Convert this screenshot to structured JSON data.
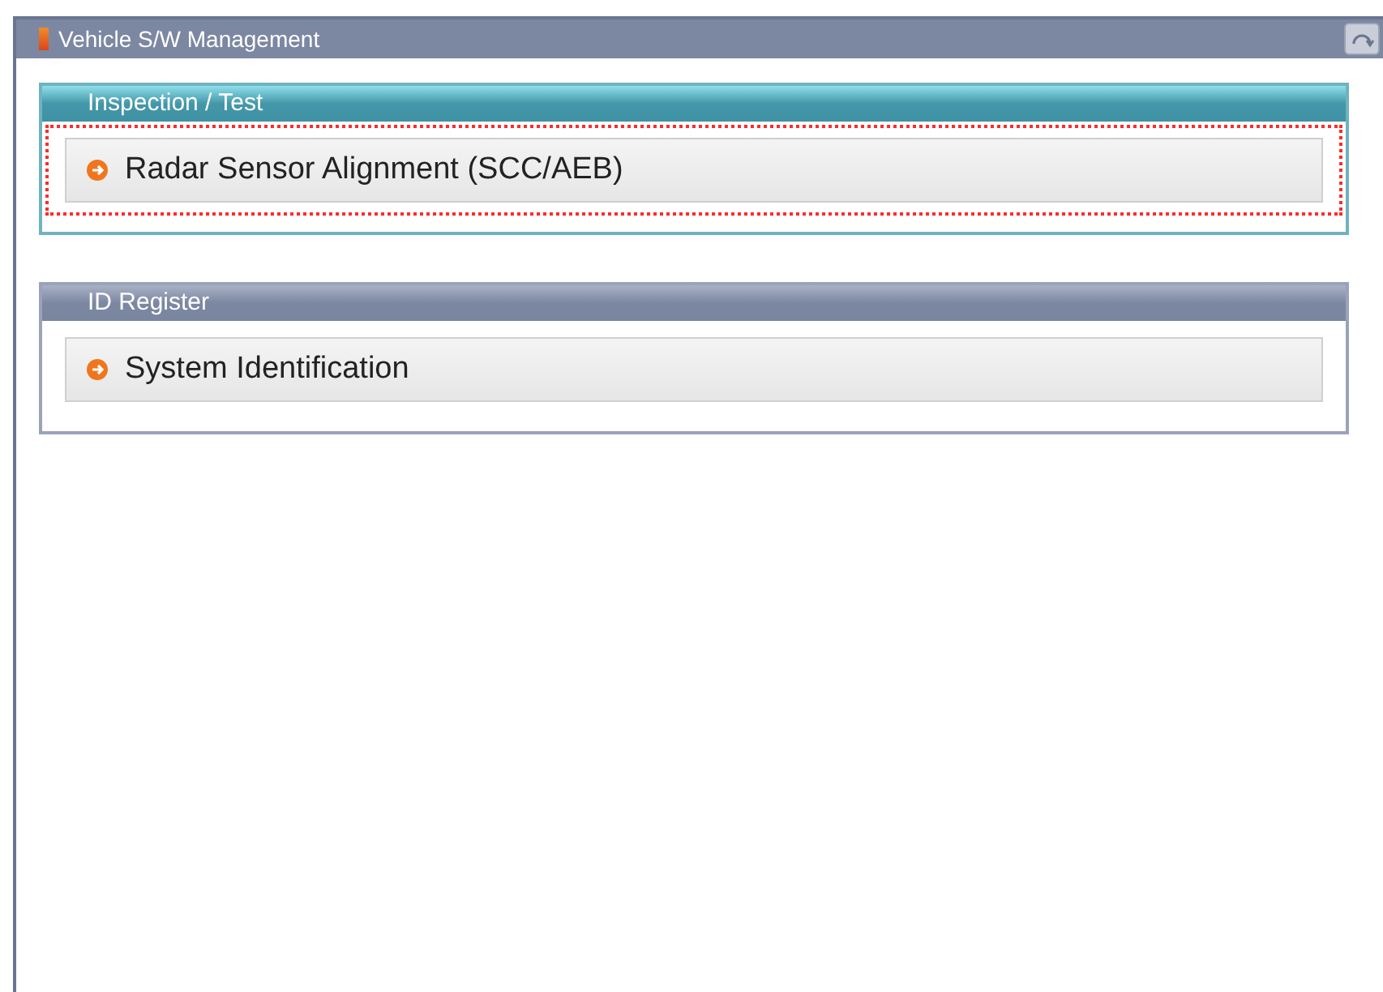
{
  "window": {
    "title": "Vehicle S/W Management"
  },
  "sections": [
    {
      "title": "Inspection / Test",
      "active": true,
      "items": [
        {
          "label": "Radar Sensor Alignment (SCC/AEB)",
          "highlighted": true
        }
      ]
    },
    {
      "title": "ID Register",
      "active": false,
      "items": [
        {
          "label": "System Identification",
          "highlighted": false
        }
      ]
    }
  ]
}
